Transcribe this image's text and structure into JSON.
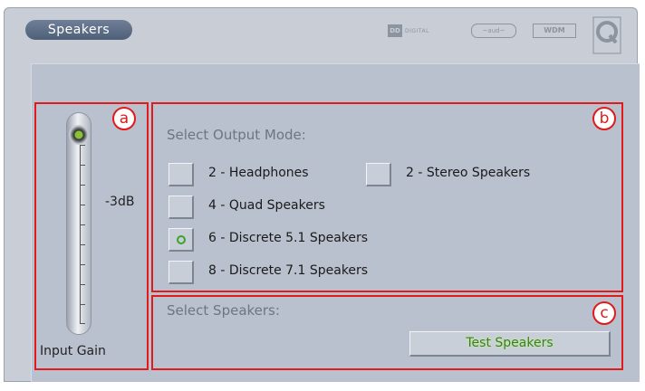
{
  "app": {
    "tab_label": "Speakers"
  },
  "logos": {
    "digital": "DIGITAL",
    "wdm": "WDM"
  },
  "input_gain": {
    "label": "Input Gain",
    "level_text": "-3dB",
    "level_fraction": 0.95
  },
  "output_mode": {
    "heading": "Select Output Mode:",
    "options": [
      {
        "label": "2 - Headphones",
        "selected": false
      },
      {
        "label": "2 - Stereo Speakers",
        "selected": false
      },
      {
        "label": "4 - Quad Speakers",
        "selected": false
      },
      {
        "label": "6 - Discrete 5.1 Speakers",
        "selected": true
      },
      {
        "label": "8 - Discrete 7.1 Speakers",
        "selected": false
      }
    ]
  },
  "speakers": {
    "heading": "Select Speakers:",
    "test_button": "Test Speakers"
  },
  "annotations": {
    "a": "a",
    "b": "b",
    "c": "c"
  },
  "colors": {
    "annotation_red": "#e21a1a",
    "active_green": "#3da22a",
    "tab_blue": "#5a6b84"
  }
}
